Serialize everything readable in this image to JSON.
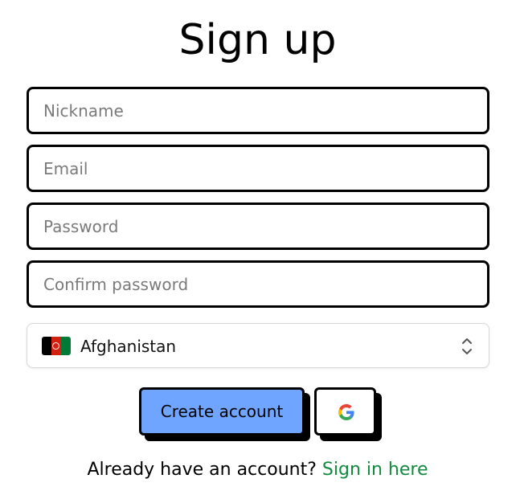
{
  "page": {
    "title": "Sign up"
  },
  "form": {
    "nickname": {
      "placeholder": "Nickname",
      "value": ""
    },
    "email": {
      "placeholder": "Email",
      "value": ""
    },
    "password": {
      "placeholder": "Password",
      "value": ""
    },
    "confirm_password": {
      "placeholder": "Confirm password",
      "value": ""
    },
    "country": {
      "selected": "Afghanistan",
      "flag_icon": "afghanistan-flag-icon",
      "chevron_icon": "up-down-chevron-icon"
    }
  },
  "actions": {
    "create_account_label": "Create account",
    "google_icon": "google-icon"
  },
  "footer": {
    "prompt": "Already have an account?",
    "link_label": "Sign in here"
  },
  "colors": {
    "primary_button": "#6fa5ff",
    "link": "#138a3e",
    "border": "#000000"
  }
}
